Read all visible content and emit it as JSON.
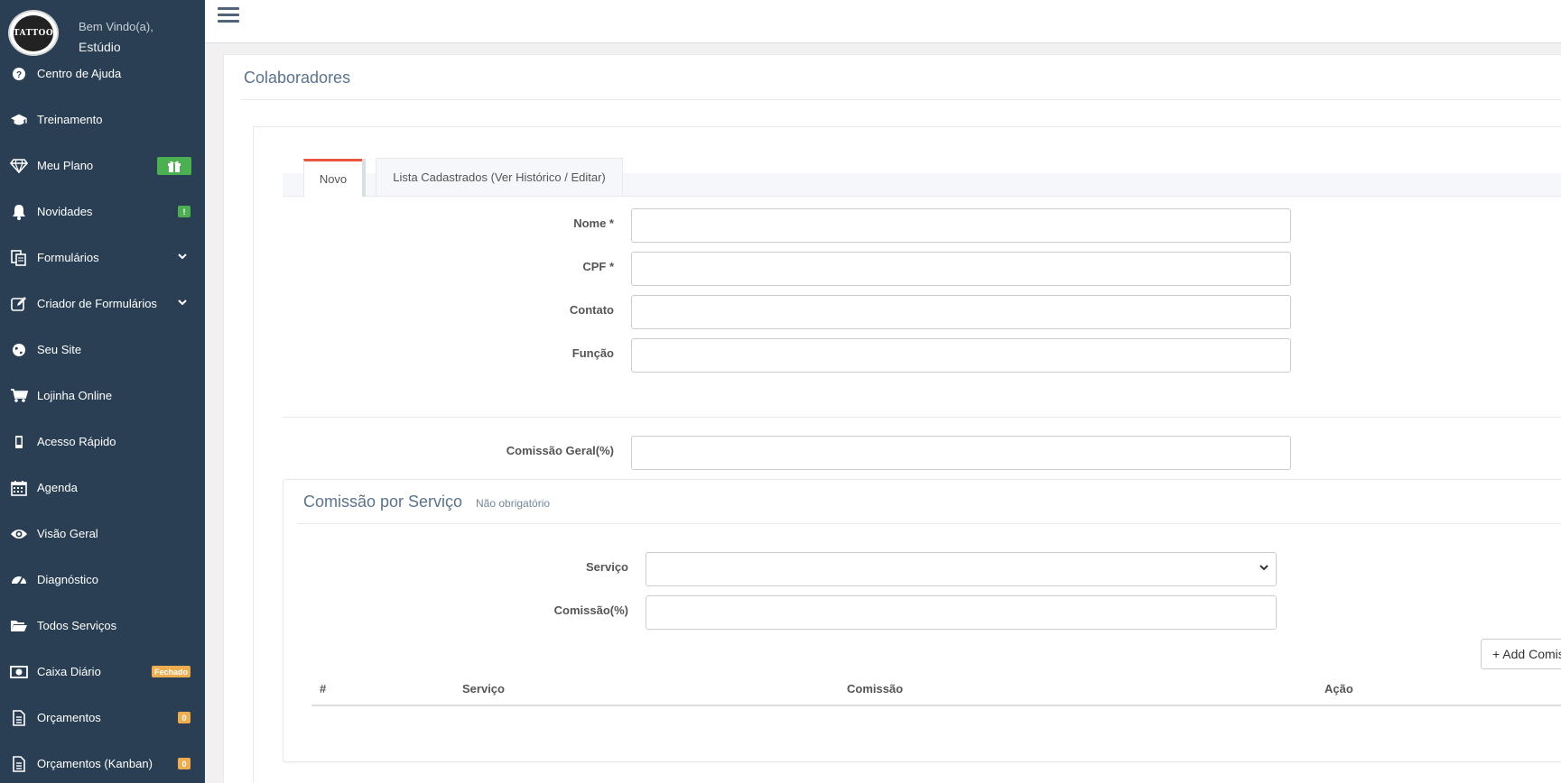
{
  "profile": {
    "avatar_text": "TATTOO",
    "welcome": "Bem Vindo(a),",
    "name": "Estúdio"
  },
  "sidebar": {
    "items": [
      {
        "label": "Centro de Ajuda",
        "icon": "question-circle-icon"
      },
      {
        "label": "Treinamento",
        "icon": "graduation-cap-icon"
      },
      {
        "label": "Meu Plano",
        "icon": "diamond-icon",
        "badge_icon": "gift-icon"
      },
      {
        "label": "Novidades",
        "icon": "bell-icon",
        "badge": "!"
      },
      {
        "label": "Formulários",
        "icon": "files-icon"
      },
      {
        "label": "Criador de Formulários",
        "icon": "edit-icon"
      },
      {
        "label": "Seu Site",
        "icon": "globe-icon"
      },
      {
        "label": "Lojinha Online",
        "icon": "cart-icon"
      },
      {
        "label": "Acesso Rápido",
        "icon": "mobile-icon"
      },
      {
        "label": "Agenda",
        "icon": "calendar-icon"
      },
      {
        "label": "Visão Geral",
        "icon": "eye-icon"
      },
      {
        "label": "Diagnóstico",
        "icon": "dashboard-icon"
      },
      {
        "label": "Todos Serviços",
        "icon": "folder-open-icon"
      },
      {
        "label": "Caixa Diário",
        "icon": "money-icon",
        "badge": "Fechado"
      },
      {
        "label": "Orçamentos",
        "icon": "document-icon",
        "badge": "0"
      },
      {
        "label": "Orçamentos (Kanban)",
        "icon": "document-icon",
        "badge": "0"
      }
    ]
  },
  "page": {
    "title": "Colaboradores"
  },
  "tabs": {
    "novo": "Novo",
    "lista": "Lista Cadastrados (Ver Histórico / Editar)"
  },
  "form": {
    "nome_label": "Nome *",
    "cpf_label": "CPF *",
    "contato_label": "Contato",
    "funcao_label": "Função",
    "comissao_geral_label": "Comissão Geral(%)"
  },
  "comissao_servico": {
    "title": "Comissão por Serviço",
    "note": "Não obrigatório",
    "servico_label": "Serviço",
    "comissao_label": "Comissão(%)",
    "add_button": "+ Add Comis",
    "table_headers": [
      "#",
      "Serviço",
      "Comissão",
      "Ação"
    ]
  },
  "colors": {
    "sidebar_bg": "#2a3f54",
    "accent_tab": "#e9573f",
    "badge_green": "#4caf50",
    "badge_orange": "#f0ad4e"
  }
}
